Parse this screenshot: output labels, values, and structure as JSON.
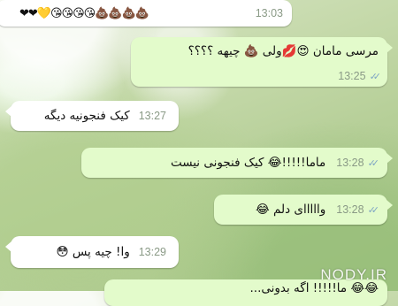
{
  "messages": [
    {
      "id": "m1",
      "direction": "incoming",
      "text": "❤❤💛😘😘😘😘💩💩💩💩",
      "time": "13:03"
    },
    {
      "id": "m2",
      "direction": "outgoing",
      "text": "مرسی مامان 😍💋ولی 💩 چیهه ؟؟؟؟",
      "time": "13:25",
      "status": "read"
    },
    {
      "id": "m3",
      "direction": "incoming",
      "text": "کیک فنجونیه دیگه",
      "time": "13:27"
    },
    {
      "id": "m4",
      "direction": "outgoing",
      "text": "ماما!!!!!😂 کیک فنجونی نیست",
      "time": "13:28",
      "status": "read"
    },
    {
      "id": "m5",
      "direction": "outgoing",
      "text": "وااااای دلم 😂",
      "time": "13:28",
      "status": "read"
    },
    {
      "id": "m6",
      "direction": "incoming",
      "text": "وا! چیه پس 😳",
      "time": "13:29"
    },
    {
      "id": "m7",
      "direction": "outgoing",
      "text": "😂😂 ما!!!!! اگه بدونی...",
      "time": "",
      "status": ""
    }
  ],
  "status_icons": {
    "read": "✓✓"
  },
  "colors": {
    "incoming": "#ffffff",
    "outgoing": "#e3fbcb",
    "tick": "#7fa6c4"
  },
  "watermark": "NODY.IR"
}
